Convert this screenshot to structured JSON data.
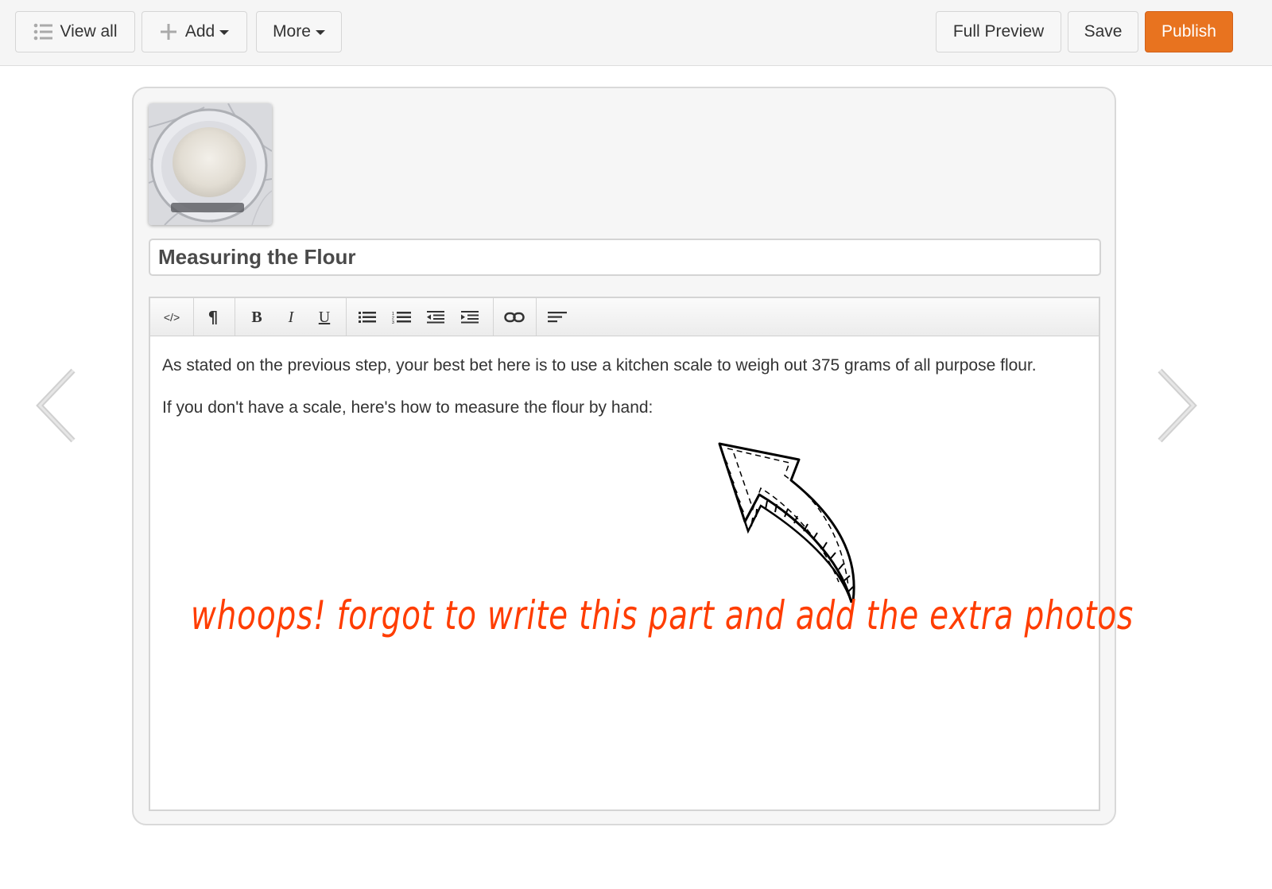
{
  "toolbar": {
    "view_all": "View all",
    "add": "Add",
    "more": "More",
    "full_preview": "Full Preview",
    "save": "Save",
    "publish": "Publish",
    "publish_color": "#e8731f"
  },
  "step": {
    "title": "Measuring the Flour",
    "paragraphs": [
      "As stated on the previous step, your best bet here is to use a kitchen scale to weigh out 375 grams of all purpose flour.",
      "If you don't have a scale, here's how to measure the flour by hand:"
    ]
  },
  "editor_toolbar": {
    "icons": [
      "code-icon",
      "paragraph-icon",
      "bold-icon",
      "italic-icon",
      "underline-icon",
      "bullet-list-icon",
      "numbered-list-icon",
      "outdent-icon",
      "indent-icon",
      "link-icon",
      "align-icon"
    ]
  },
  "annotation": {
    "text": "whoops! forgot to write this part and add the extra photos",
    "color": "#ff3d00"
  }
}
